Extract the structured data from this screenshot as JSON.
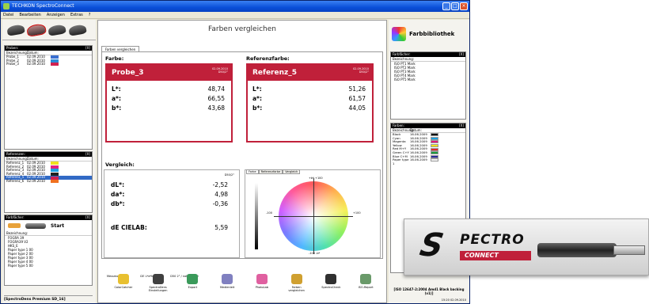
{
  "window": {
    "title": "TECHKON SpectroConnect"
  },
  "menu": [
    "Datei",
    "Bearbeiten",
    "Anzeigen",
    "Extras",
    "?"
  ],
  "proben": {
    "title": "Proben:",
    "close": "[X]",
    "headers": [
      "Bezeichnung:",
      "Datum:"
    ],
    "rows": [
      {
        "name": "Probe_1",
        "date": "02.09.2010",
        "color": "#3a6fd0"
      },
      {
        "name": "Probe_2",
        "date": "02.09.2010",
        "color": "#2a8ad8"
      },
      {
        "name": "Probe_3",
        "date": "02.09.2010",
        "color": "#d02050"
      }
    ]
  },
  "referenzen": {
    "title": "Referenzen:",
    "close": "[X]",
    "headers": [
      "Bezeichnung:",
      "Datum:"
    ],
    "rows": [
      {
        "name": "Referenz_1",
        "date": "02.09.2010",
        "color": "#f0e020"
      },
      {
        "name": "Referenz_2",
        "date": "02.09.2010",
        "color": "#e02080"
      },
      {
        "name": "Referenz_3",
        "date": "02.09.2010",
        "color": "#20a0e0"
      },
      {
        "name": "Referenz_4",
        "date": "02.09.2010",
        "color": "#202020"
      },
      {
        "name": "Referenz_5",
        "date": "02.09.2010",
        "color": "#d02050",
        "selected": true
      },
      {
        "name": "Referenz_6",
        "date": "02.09.2010",
        "color": "#f07020"
      }
    ]
  },
  "farbfaecher": {
    "title": "Farbfächer:",
    "close": "[X]",
    "start": "Start",
    "header": "Bezeichnung:",
    "items": [
      "FOGRA 39",
      "FOGRA39 V2",
      "HKS_E",
      "Paper type 1 00",
      "Paper type 2 00",
      "Paper type 3 00",
      "Paper type 4 00",
      "Paper type 5 00"
    ]
  },
  "left_footer": "[SpectroDens Premium SD_16]",
  "main": {
    "page_title": "Farben vergleichen",
    "tab": "Farben vergleichen",
    "farbe_label": "Farbe:",
    "ref_label": "Referenzfarbe:",
    "probe": {
      "name": "Probe_3",
      "date": "02.09.2010",
      "cond": "D50/2°",
      "L": "48,74",
      "a": "66,55",
      "b": "43,68"
    },
    "referenz": {
      "name": "Referenz_5",
      "date": "02.09.2010",
      "cond": "D50/2°",
      "L": "51,26",
      "a": "61,57",
      "b": "44,05"
    },
    "lab_labels": [
      "L*:",
      "a*:",
      "b*:"
    ],
    "vergleich_label": "Vergleich:",
    "vergleich_note": "D50/2°",
    "dL": {
      "label": "dL*:",
      "value": "-2,52"
    },
    "da": {
      "label": "da*:",
      "value": "4,98"
    },
    "db": {
      "label": "db*:",
      "value": "-0,36"
    },
    "de": {
      "label": "dE CIELAB:",
      "value": "5,59"
    },
    "graph_tabs": [
      "Farbe",
      "Referenzfarbe",
      "Vergleich"
    ],
    "graph_labels": {
      "top": "+b* +100",
      "bottom": "-100 -b*",
      "left": "-100",
      "right": "+100"
    },
    "messmodus_label": "Messmodus:",
    "messmodus_value": "CIE L*a*b*",
    "messmodus_extra": "D50 2° / noPOL / M0"
  },
  "toolbar": [
    {
      "label": "ColorCatcher",
      "color": "#e8c030"
    },
    {
      "label": "SpectroDens Einstellungen",
      "color": "#404040"
    },
    {
      "label": "Export",
      "color": "#3a9a5a"
    },
    {
      "label": "Medienleit",
      "color": "#8080c0"
    },
    {
      "label": "PhotoLab",
      "color": "#e060a0"
    },
    {
      "label": "Farben vergleichen",
      "color": "#d0a030"
    },
    {
      "label": "SpectroCheck",
      "color": "#303030"
    },
    {
      "label": "ISO-Report",
      "color": "#6a9a6a"
    }
  ],
  "library": {
    "title": "Farbbibliothek"
  },
  "faecher_right": {
    "title": "Farbfächer:",
    "close": "[X]",
    "header": "Bezeichnung:",
    "items": [
      "ISO PT1 Mark",
      "ISO PT2 Mark",
      "ISO PT3 Mark",
      "ISO PT4 Mark",
      "ISO PT5 Mark"
    ]
  },
  "farben_right": {
    "title": "Farben:",
    "close": "[X]",
    "headers": [
      "Bezeichnung:",
      "Datum:"
    ],
    "rows": [
      {
        "name": "Black",
        "date": "16.06.2009",
        "color": "#111111"
      },
      {
        "name": "Cyan",
        "date": "16.06.2009",
        "color": "#1aa0e0"
      },
      {
        "name": "Magenta",
        "date": "16.06.2009",
        "color": "#e0187a"
      },
      {
        "name": "Yellow",
        "date": "16.06.2009",
        "color": "#f2e21a"
      },
      {
        "name": "Red M+Y",
        "date": "16.06.2009",
        "color": "#e02828"
      },
      {
        "name": "Green C+Y",
        "date": "16.06.2009",
        "color": "#1a9a3a"
      },
      {
        "name": "Blue C+M",
        "date": "16.06.2009",
        "color": "#2a2a9a"
      },
      {
        "name": "Paper type 1",
        "date": "16.06.2009",
        "color": "#f4f4f4"
      }
    ]
  },
  "right_footer": "[ISO 12647-2:2004 Amd1 Black backing (v1)]",
  "clock": "15:20  02.09.2010",
  "logo": {
    "s": "S",
    "spectro": "PECTRO",
    "connect": "CONNECT"
  }
}
